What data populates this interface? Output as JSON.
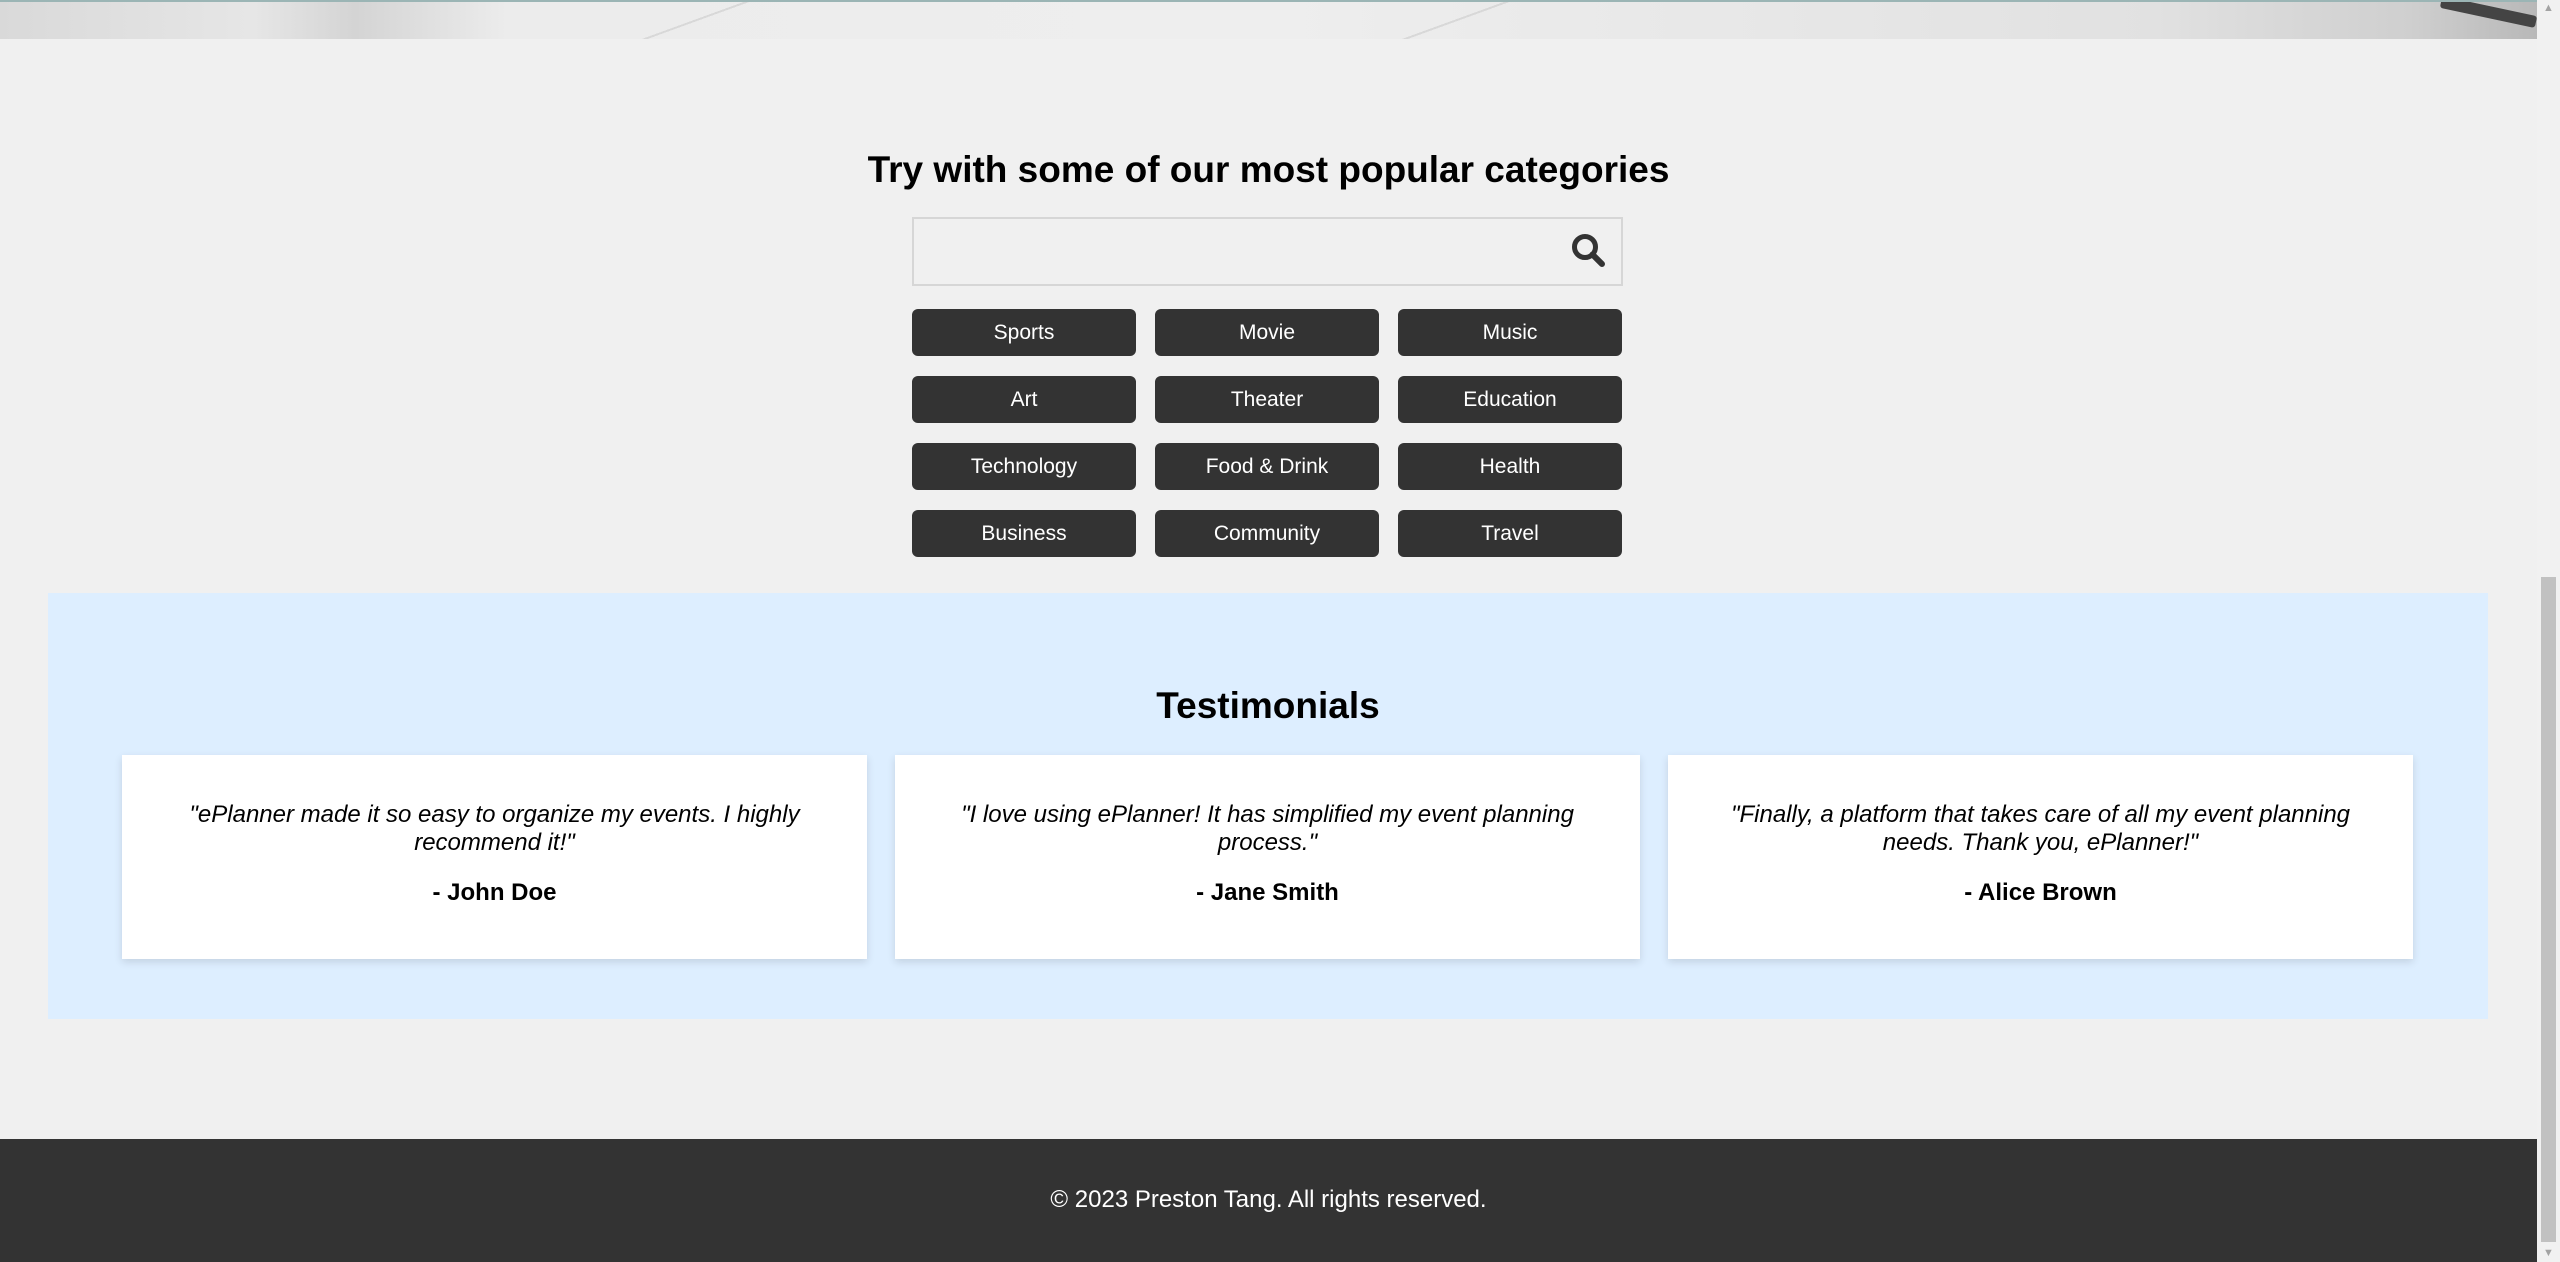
{
  "categories_section": {
    "title": "Try with some of our most popular categories",
    "search": {
      "placeholder": "",
      "icon": "search-icon"
    },
    "items": [
      {
        "label": "Sports"
      },
      {
        "label": "Movie"
      },
      {
        "label": "Music"
      },
      {
        "label": "Art"
      },
      {
        "label": "Theater"
      },
      {
        "label": "Education"
      },
      {
        "label": "Technology"
      },
      {
        "label": "Food & Drink"
      },
      {
        "label": "Health"
      },
      {
        "label": "Business"
      },
      {
        "label": "Community"
      },
      {
        "label": "Travel"
      }
    ]
  },
  "testimonials": {
    "title": "Testimonials",
    "items": [
      {
        "quote": "\"ePlanner made it so easy to organize my events. I highly recommend it!\"",
        "author": "- John Doe"
      },
      {
        "quote": "\"I love using ePlanner! It has simplified my event planning process.\"",
        "author": "- Jane Smith"
      },
      {
        "quote": "\"Finally, a platform that takes care of all my event planning needs. Thank you, ePlanner!\"",
        "author": "- Alice Brown"
      }
    ]
  },
  "footer": {
    "text": "© 2023 Preston Tang. All rights reserved."
  },
  "colors": {
    "page_bg": "#f0f0f0",
    "button_bg": "#333333",
    "testimonials_bg": "#ddeeff",
    "footer_bg": "#333333"
  }
}
